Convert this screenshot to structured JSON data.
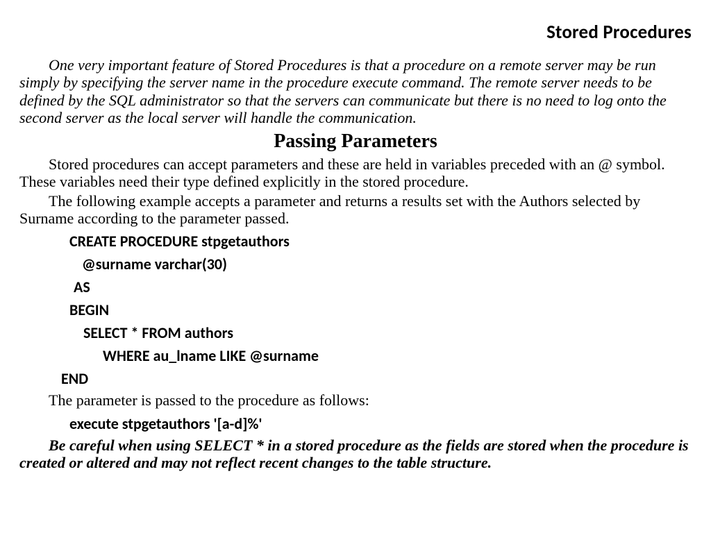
{
  "page_title": "Stored Procedures",
  "intro_italic": "One very important feature of Stored Procedures is that a procedure on a remote server may be run simply by specifying the server name in the procedure execute command. The remote server needs to be defined by the SQL administrator so that the servers can communicate but there is no need to log onto the second server as the local server will handle the communication.",
  "section_heading": "Passing Parameters",
  "para1": "Stored procedures can accept parameters and these are held in variables preceded with an @ symbol. These variables need their type defined explicitly in the stored procedure.",
  "para2": "The following  example accepts a parameter and returns a results set with the Authors selected by Surname according to the parameter passed.",
  "code": {
    "line1": "CREATE PROCEDURE stpgetauthors",
    "line2": "@surname varchar(30)",
    "line3": "AS",
    "line4": "BEGIN",
    "line5": "SELECT * FROM authors",
    "line6": "WHERE au_lname LIKE @surname",
    "line7": "END"
  },
  "para3": "The parameter is passed to the procedure as follows:",
  "code2": {
    "line1": "execute stpgetauthors '[a-d]%'"
  },
  "warning": "Be careful when using SELECT * in a stored procedure as the fields are stored when the procedure is created or altered and may not reflect recent changes to the table structure."
}
